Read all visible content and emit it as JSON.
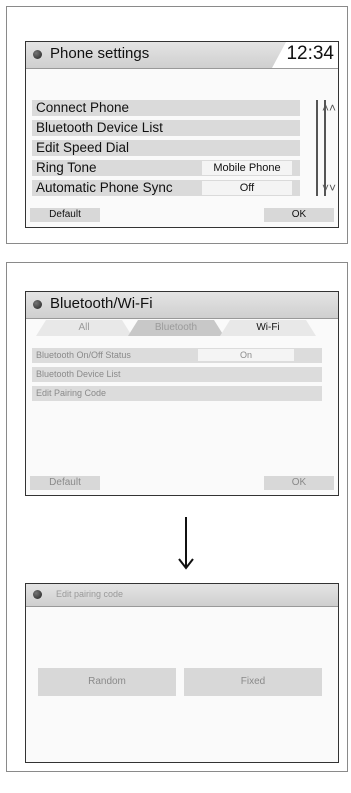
{
  "panel1": {
    "title": "Phone settings",
    "clock": "12:34",
    "rows": [
      {
        "label": "Connect Phone",
        "value": null
      },
      {
        "label": "Bluetooth Device List",
        "value": null
      },
      {
        "label": "Edit Speed Dial",
        "value": null
      },
      {
        "label": "Ring Tone",
        "value": "Mobile Phone"
      },
      {
        "label": "Automatic Phone Sync",
        "value": "Off"
      }
    ],
    "scroll_up_icon": "double-chevron-up-icon",
    "scroll_down_icon": "double-chevron-down-icon",
    "default_label": "Default",
    "ok_label": "OK"
  },
  "panel2": {
    "title": "Bluetooth/Wi-Fi",
    "tabs": [
      "All",
      "Bluetooth",
      "Wi-Fi"
    ],
    "active_tab": "Bluetooth",
    "rows": [
      {
        "label": "Bluetooth On/Off Status",
        "value": "On"
      },
      {
        "label": "Bluetooth Device List",
        "value": null
      },
      {
        "label": "Edit Pairing Code",
        "value": null
      }
    ],
    "default_label": "Default",
    "ok_label": "OK"
  },
  "panel3": {
    "title": "Edit pairing code",
    "random_label": "Random",
    "fixed_label": "Fixed"
  },
  "colors": {
    "screen_bg": "#fafafa",
    "row_bg": "#dadada",
    "title_bar": "#d6d6d6"
  }
}
